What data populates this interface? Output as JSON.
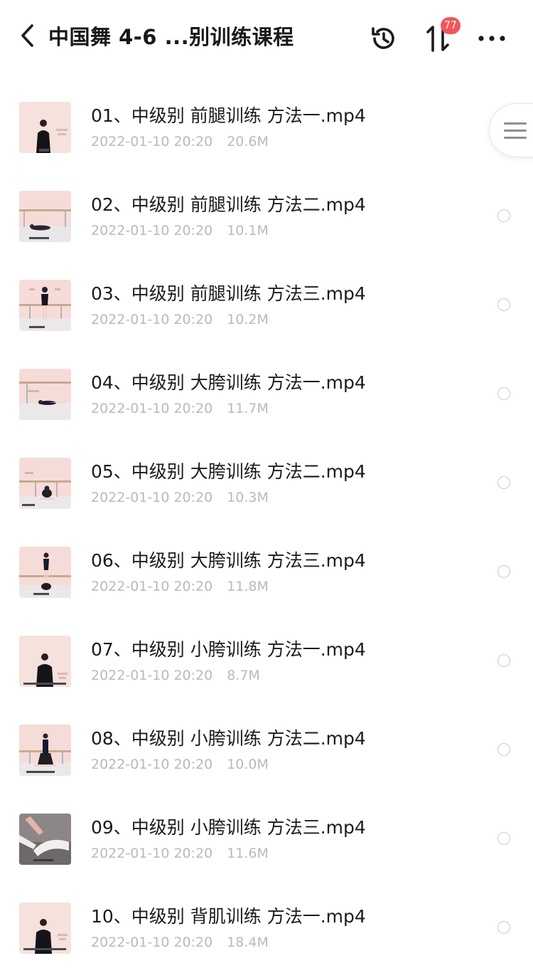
{
  "header": {
    "title": "中国舞 4-6 ...别训练课程",
    "sort_badge": "77",
    "icons": {
      "back": "chevron-left-icon",
      "history": "history-clock-icon",
      "sort": "sort-arrows-icon",
      "more": "more-dots-icon",
      "side_menu": "menu-lines-icon"
    }
  },
  "colors": {
    "title": "#18181c",
    "filename": "#1b1b1f",
    "meta": "#b8b9c1",
    "badge": "#f2565c",
    "thumb_bg": "#f6dcd8"
  },
  "files": [
    {
      "name": "01、中级别 前腿训练 方法一.mp4",
      "date": "2022-01-10 20:20",
      "size": "20.6M"
    },
    {
      "name": "02、中级别 前腿训练 方法二.mp4",
      "date": "2022-01-10 20:20",
      "size": "10.1M"
    },
    {
      "name": "03、中级别 前腿训练 方法三.mp4",
      "date": "2022-01-10 20:20",
      "size": "10.2M"
    },
    {
      "name": "04、中级别 大胯训练 方法一.mp4",
      "date": "2022-01-10 20:20",
      "size": "11.7M"
    },
    {
      "name": "05、中级别 大胯训练 方法二.mp4",
      "date": "2022-01-10 20:20",
      "size": "10.3M"
    },
    {
      "name": "06、中级别 大胯训练 方法三.mp4",
      "date": "2022-01-10 20:20",
      "size": "11.8M"
    },
    {
      "name": "07、中级别 小胯训练 方法一.mp4",
      "date": "2022-01-10 20:20",
      "size": "8.7M"
    },
    {
      "name": "08、中级别 小胯训练 方法二.mp4",
      "date": "2022-01-10 20:20",
      "size": "10.0M"
    },
    {
      "name": "09、中级别 小胯训练 方法三.mp4",
      "date": "2022-01-10 20:20",
      "size": "11.6M"
    },
    {
      "name": "10、中级别 背肌训练 方法一.mp4",
      "date": "2022-01-10 20:20",
      "size": "18.4M"
    }
  ]
}
